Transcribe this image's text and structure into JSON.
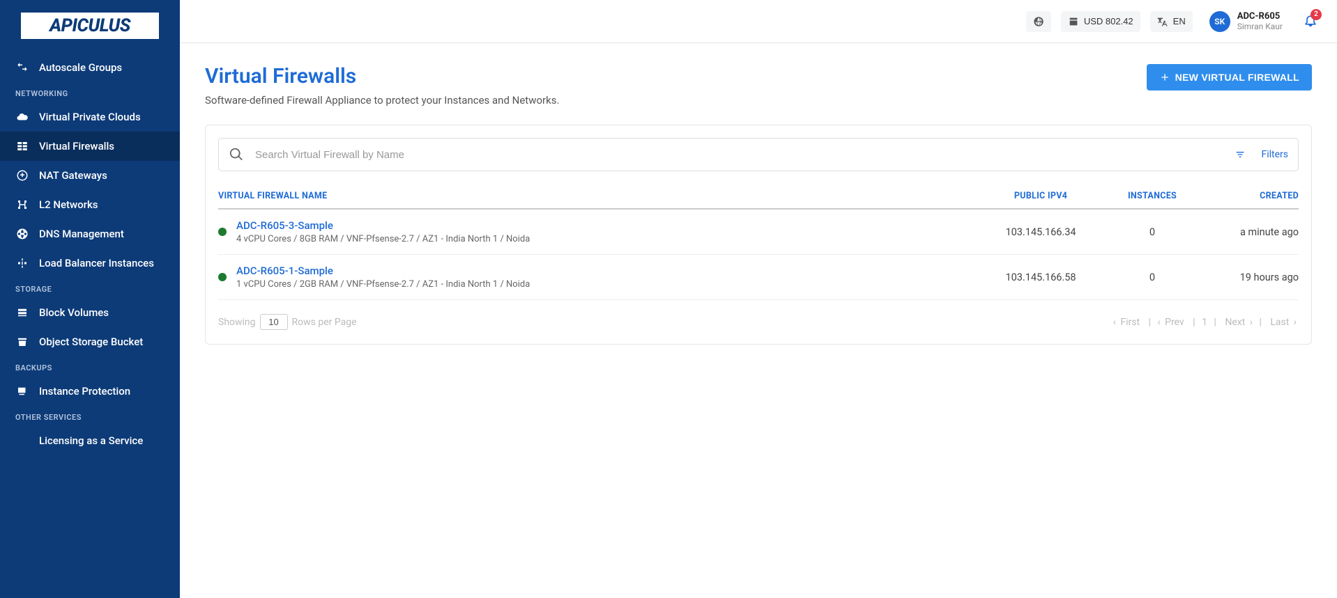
{
  "brand": "APICULUS",
  "sidebar": {
    "items": [
      {
        "label": "Autoscale Groups"
      }
    ],
    "sections": [
      {
        "heading": "NETWORKING",
        "items": [
          {
            "label": "Virtual Private Clouds"
          },
          {
            "label": "Virtual Firewalls",
            "active": true
          },
          {
            "label": "NAT Gateways"
          },
          {
            "label": "L2 Networks"
          },
          {
            "label": "DNS Management"
          },
          {
            "label": "Load Balancer Instances"
          }
        ]
      },
      {
        "heading": "STORAGE",
        "items": [
          {
            "label": "Block Volumes"
          },
          {
            "label": "Object Storage Bucket"
          }
        ]
      },
      {
        "heading": "BACKUPS",
        "items": [
          {
            "label": "Instance Protection"
          }
        ]
      },
      {
        "heading": "OTHER SERVICES",
        "items": [
          {
            "label": "Licensing as a Service"
          }
        ]
      }
    ]
  },
  "topbar": {
    "balance": "USD 802.42",
    "lang": "EN",
    "avatar_initials": "SK",
    "user_code": "ADC-R605",
    "user_name": "Simran Kaur",
    "notification_count": "2"
  },
  "page": {
    "title": "Virtual Firewalls",
    "subtitle": "Software-defined Firewall Appliance to protect your Instances and Networks.",
    "new_button": "NEW VIRTUAL FIREWALL",
    "search_placeholder": "Search Virtual Firewall by Name",
    "filters_label": "Filters"
  },
  "table": {
    "headers": {
      "name": "VIRTUAL FIREWALL NAME",
      "ip": "PUBLIC IPV4",
      "instances": "INSTANCES",
      "created": "CREATED"
    },
    "rows": [
      {
        "name": "ADC-R605-3-Sample",
        "spec": "4 vCPU Cores / 8GB RAM / VNF-Pfsense-2.7 / AZ1 - India North 1 / Noida",
        "ip": "103.145.166.34",
        "instances": "0",
        "created": "a minute ago"
      },
      {
        "name": "ADC-R605-1-Sample",
        "spec": "1 vCPU Cores / 2GB RAM / VNF-Pfsense-2.7 / AZ1 - India North 1 / Noida",
        "ip": "103.145.166.58",
        "instances": "0",
        "created": "19 hours ago"
      }
    ]
  },
  "pagination": {
    "showing": "Showing",
    "rows_value": "10",
    "rows_label": "Rows per Page",
    "first": "First",
    "prev": "Prev",
    "page": "1",
    "next": "Next",
    "last": "Last"
  }
}
